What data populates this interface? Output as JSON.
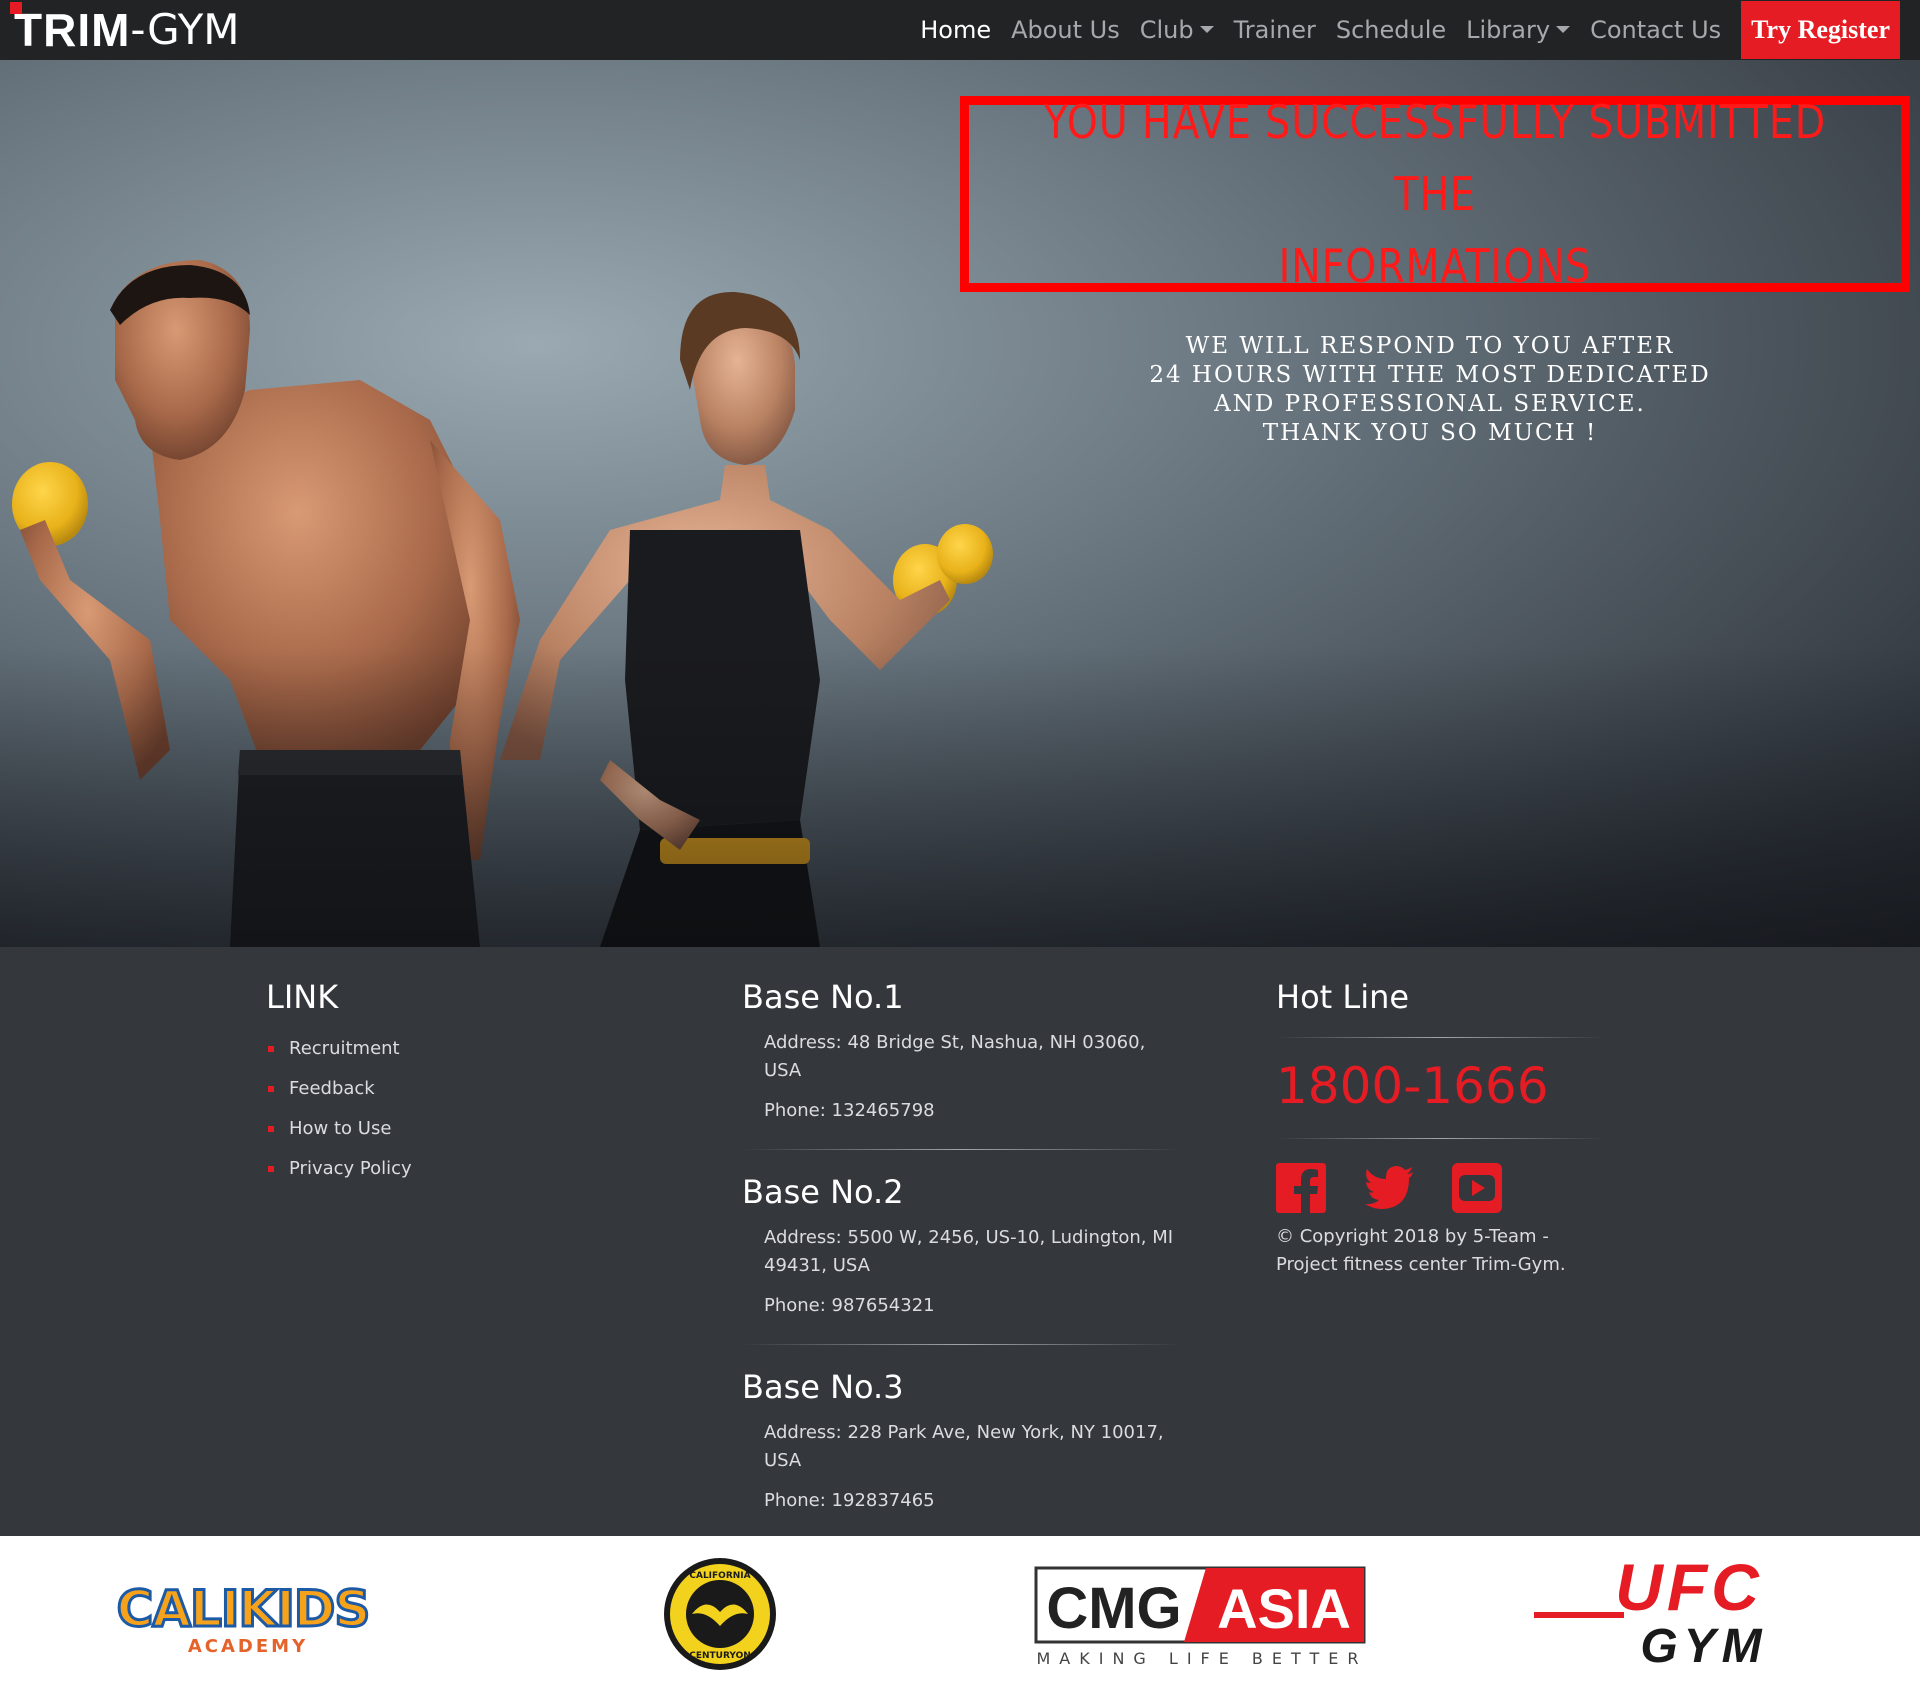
{
  "navbar": {
    "brand_bold": "TRIM",
    "brand_rest": "-GYM",
    "items": [
      {
        "label": "Home",
        "active": true,
        "dropdown": false
      },
      {
        "label": "About Us",
        "active": false,
        "dropdown": false
      },
      {
        "label": "Club",
        "active": false,
        "dropdown": true
      },
      {
        "label": "Trainer",
        "active": false,
        "dropdown": false
      },
      {
        "label": "Schedule",
        "active": false,
        "dropdown": false
      },
      {
        "label": "Library",
        "active": false,
        "dropdown": true
      },
      {
        "label": "Contact Us",
        "active": false,
        "dropdown": false
      }
    ],
    "register_label": "Try Register"
  },
  "hero": {
    "success_lines": [
      "YOU HAVE SUCCESSFULLY SUBMITTED THE",
      "INFORMATIONS"
    ],
    "respond_lines": [
      "WE WILL RESPOND TO YOU AFTER",
      "24 HOURS WITH THE MOST DEDICATED",
      "AND PROFESSIONAL SERVICE.",
      "THANK YOU SO MUCH !"
    ]
  },
  "footer": {
    "link_title": "LINK",
    "links": [
      "Recruitment",
      "Feedback",
      "How to Use",
      "Privacy Policy"
    ],
    "bases": [
      {
        "title": "Base No.1",
        "address": "Address: 48 Bridge St, Nashua, NH 03060, USA",
        "phone": "Phone: 132465798"
      },
      {
        "title": "Base No.2",
        "address": "Address: 5500 W, 2456, US-10, Ludington, MI 49431, USA",
        "phone": "Phone: 987654321"
      },
      {
        "title": "Base No.3",
        "address": "Address: 228 Park Ave, New York, NY 10017, USA",
        "phone": "Phone: 192837465"
      }
    ],
    "hotline_title": "Hot Line",
    "hotline_number": "1800-1666",
    "social_icons": [
      "facebook-icon",
      "twitter-icon",
      "youtube-icon"
    ],
    "copyright": "© Copyright 2018 by 5-Team - Project fitness center Trim-Gym."
  },
  "partners": {
    "calikids": {
      "main": "CALIKIDS",
      "sub": "ACADEMY"
    },
    "california": {
      "top": "CALIFORNIA",
      "bottom": "CENTURYON"
    },
    "cmg": {
      "left": "CMG",
      "right": "ASIA",
      "tagline": "MAKING LIFE BETTER"
    },
    "ufc": {
      "top": "UFC",
      "bottom": "GYM"
    }
  },
  "colors": {
    "accent": "#e51c23",
    "navbar": "#222325",
    "footer": "#34373c",
    "success_text": "#ff1a1a"
  }
}
